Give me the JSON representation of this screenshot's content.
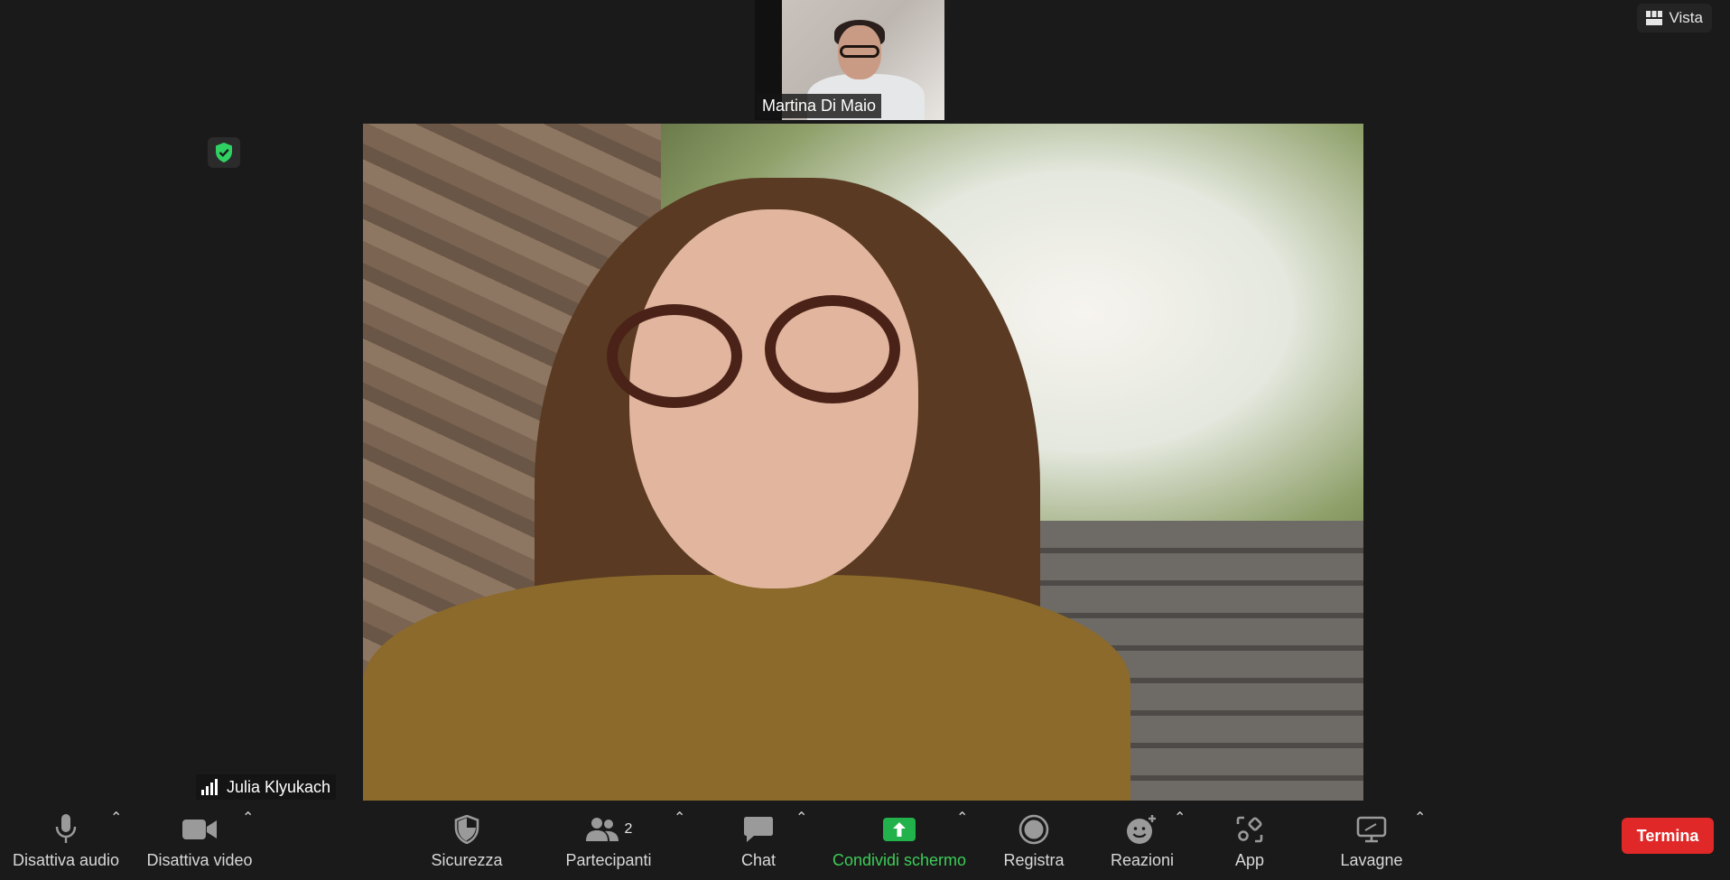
{
  "view_button": {
    "label": "Vista"
  },
  "thumbnail": {
    "name": "Martina Di Maio"
  },
  "main_video": {
    "name": "Julia Klyukach"
  },
  "toolbar": {
    "audio": "Disattiva audio",
    "video": "Disattiva video",
    "security": "Sicurezza",
    "participants": "Partecipanti",
    "participants_count": "2",
    "chat": "Chat",
    "share": "Condividi schermo",
    "record": "Registra",
    "reactions": "Reazioni",
    "apps": "App",
    "whiteboards": "Lavagne",
    "end": "Termina"
  },
  "colors": {
    "share_green": "#22b24c",
    "end_red": "#e02828",
    "secure_green": "#2fd163"
  },
  "caret": "⌃"
}
